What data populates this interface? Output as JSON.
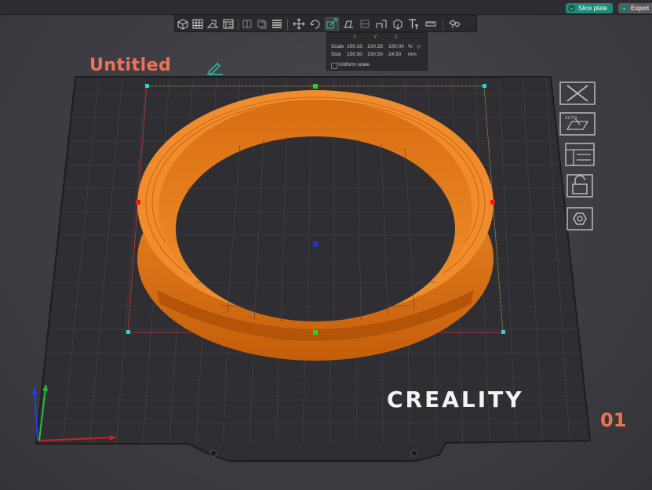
{
  "topbar": {
    "slice_label": "Slice plate",
    "export_label": "Export"
  },
  "toolbar": {
    "tools": [
      "add-object",
      "arrange",
      "orient",
      "plate-grid",
      "mirror",
      "cut-placeholder",
      "list",
      "move",
      "rotate",
      "scale",
      "flatten",
      "split",
      "support",
      "seam",
      "measure",
      "text",
      "cut",
      "assemble"
    ]
  },
  "scale_panel": {
    "axis_x": "X",
    "axis_y": "Y",
    "axis_z": "Z",
    "scale_label": "Scale",
    "size_label": "Size",
    "scale_x": "100.33",
    "scale_y": "100.33",
    "scale_z": "100.00",
    "scale_unit": "%",
    "size_x": "150.50",
    "size_y": "150.50",
    "size_z": "24.50",
    "size_unit": "mm",
    "uniform_label": "Uniform scale"
  },
  "project": {
    "title": "Untitled"
  },
  "plate": {
    "brand": "CREALITY",
    "number": "01",
    "object_color": "#e87a1e",
    "accent": "#ee7254"
  },
  "sidebar": {
    "buttons": [
      "delete-plate",
      "auto-arrange",
      "plate-layout",
      "lock-plate",
      "plate-settings"
    ],
    "auto_label": "AUTO"
  }
}
